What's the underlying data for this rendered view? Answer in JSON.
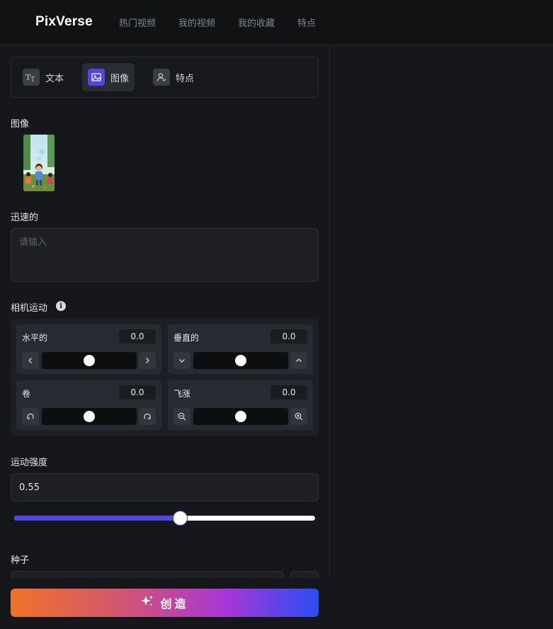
{
  "header": {
    "logo": "PixVerse",
    "nav": [
      "热门视频",
      "我的视频",
      "我的收藏",
      "特点"
    ]
  },
  "mode_tabs": [
    {
      "label": "文本",
      "icon": "text-icon"
    },
    {
      "label": "图像",
      "icon": "image-icon",
      "active": true
    },
    {
      "label": "特点",
      "icon": "character-icon"
    }
  ],
  "image_section": {
    "label": "图像",
    "thumbnail": "uploaded-image-thumbnail"
  },
  "prompt": {
    "label": "迅速的",
    "placeholder": "请输入",
    "value": ""
  },
  "camera": {
    "label": "相机运动",
    "controls": {
      "horizontal": {
        "name": "水平的",
        "value": "0.0",
        "level": 0.5
      },
      "vertical": {
        "name": "垂直的",
        "value": "0.0",
        "level": 0.5
      },
      "roll": {
        "name": "卷",
        "value": "0.0",
        "level": 0.5
      },
      "zoom": {
        "name": "飞涨",
        "value": "0.0",
        "level": 0.5
      }
    }
  },
  "motion_strength": {
    "label": "运动强度",
    "value": "0.55",
    "level": 0.55
  },
  "seed": {
    "label": "种子"
  },
  "create_button": {
    "label": "创造"
  },
  "colors": {
    "accent": "#4f46e5",
    "background": "#16171b",
    "panel": "#1e2025"
  }
}
